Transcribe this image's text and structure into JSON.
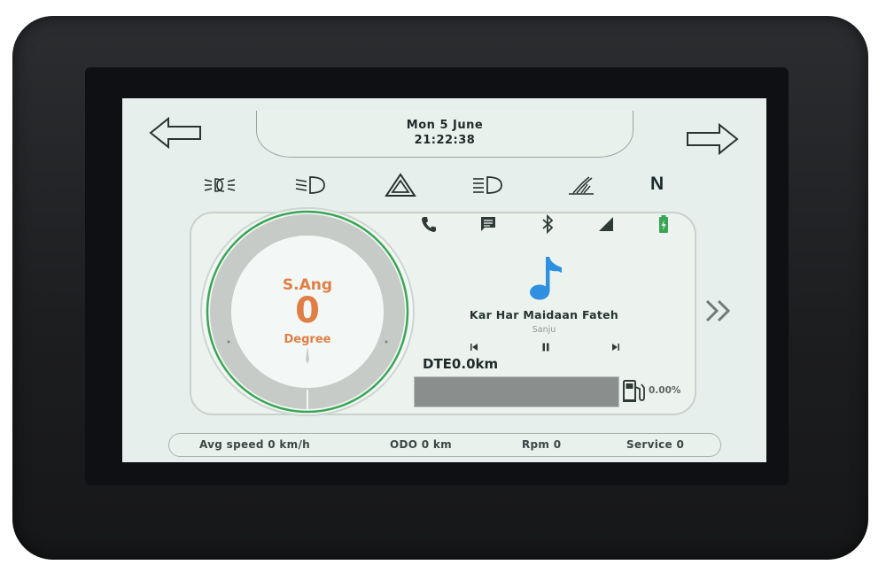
{
  "datetime": {
    "date": "Mon 5 June",
    "time": "21:22:38"
  },
  "telltales": [
    {
      "icon": "parking-light-icon"
    },
    {
      "icon": "low-beam-icon"
    },
    {
      "icon": "hazard-icon"
    },
    {
      "icon": "high-beam-icon"
    },
    {
      "icon": "side-stand-icon"
    }
  ],
  "gear": "N",
  "status_icons": [
    "phone-icon",
    "message-icon",
    "bluetooth-icon",
    "signal-icon",
    "battery-icon"
  ],
  "gauge": {
    "label": "S.Ang",
    "value": "0",
    "unit": "Degree",
    "ring_color": "#3aa655"
  },
  "media": {
    "song": "Kar Har Maidaan Fateh",
    "artist": "Sanju",
    "note_color": "#2f8fe0"
  },
  "dte": {
    "text": "DTE0.0km",
    "fuel_percent_text": "0.00%",
    "fuel_level": 0.0
  },
  "bottom": {
    "avg_speed": "Avg speed 0 km/h",
    "odo": "ODO 0 km",
    "rpm": "Rpm 0",
    "service": "Service 0"
  }
}
